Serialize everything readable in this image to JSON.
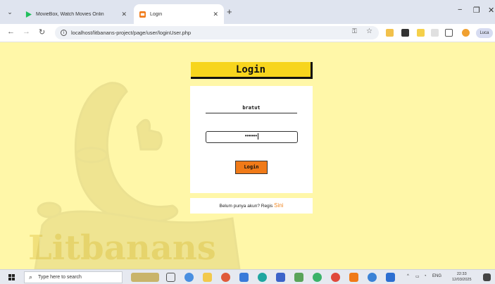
{
  "browser": {
    "tabs": [
      {
        "title": "MovieBox, Watch Movies Onlin",
        "active": false
      },
      {
        "title": "Login",
        "active": true
      }
    ],
    "url": "localhost/litbanans-project/page/user/loginUser.php",
    "profile_label": "Luca"
  },
  "page": {
    "heading": "Login",
    "username_value": "bratut",
    "password_value": "•••••••",
    "login_button": "Login",
    "footer_text": "Belum punya akun? Regis ",
    "footer_link": "Sini",
    "watermark_text": "Litbanans"
  },
  "taskbar": {
    "search_placeholder": "Type here to search",
    "language": "ENG",
    "time": "22:33",
    "date": "12/03/2025"
  },
  "colors": {
    "page_bg": "#fff7a8",
    "title_bg": "#f7d51d",
    "button_bg": "#f07a18",
    "link": "#f08a28"
  }
}
